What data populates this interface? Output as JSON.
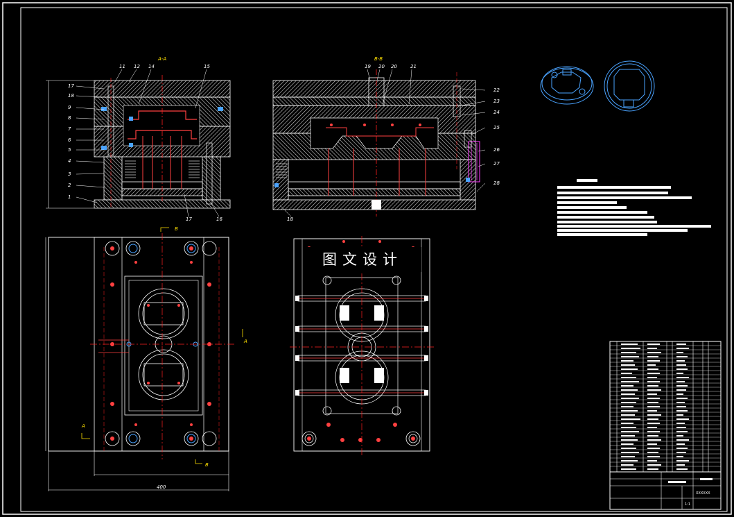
{
  "watermark": "图文设计",
  "section_labels": {
    "aa": "A-A",
    "bb": "B-B"
  },
  "view_letters": {
    "a": "A",
    "b": "B"
  },
  "dimension_label": "400",
  "left_callouts": [
    "17",
    "18",
    "9",
    "8",
    "7",
    "6",
    "5",
    "4",
    "3",
    "2",
    "1"
  ],
  "left_top_callouts": [
    "11",
    "12",
    "14",
    "15"
  ],
  "left_bottom_callouts": [
    "17",
    "16"
  ],
  "mid_top_callouts": [
    "19",
    "20",
    "20",
    "21"
  ],
  "mid_right_callouts": [
    "22",
    "23",
    "24",
    "25",
    "26",
    "27",
    "28"
  ],
  "mid_bottom_callouts": [
    "18"
  ],
  "title_block": {
    "drawing_no": "XXXXXX",
    "scale": "1:1"
  },
  "colors": {
    "background": "#000000",
    "lines": "#ffffff",
    "centerline": "#ff2020",
    "pin": "#ff4040",
    "hatch": "#d0d0d0",
    "iso": "#4aa3ff",
    "label": "#ffe000",
    "dim": "#00e0e0",
    "magenta": "#ff40ff"
  }
}
